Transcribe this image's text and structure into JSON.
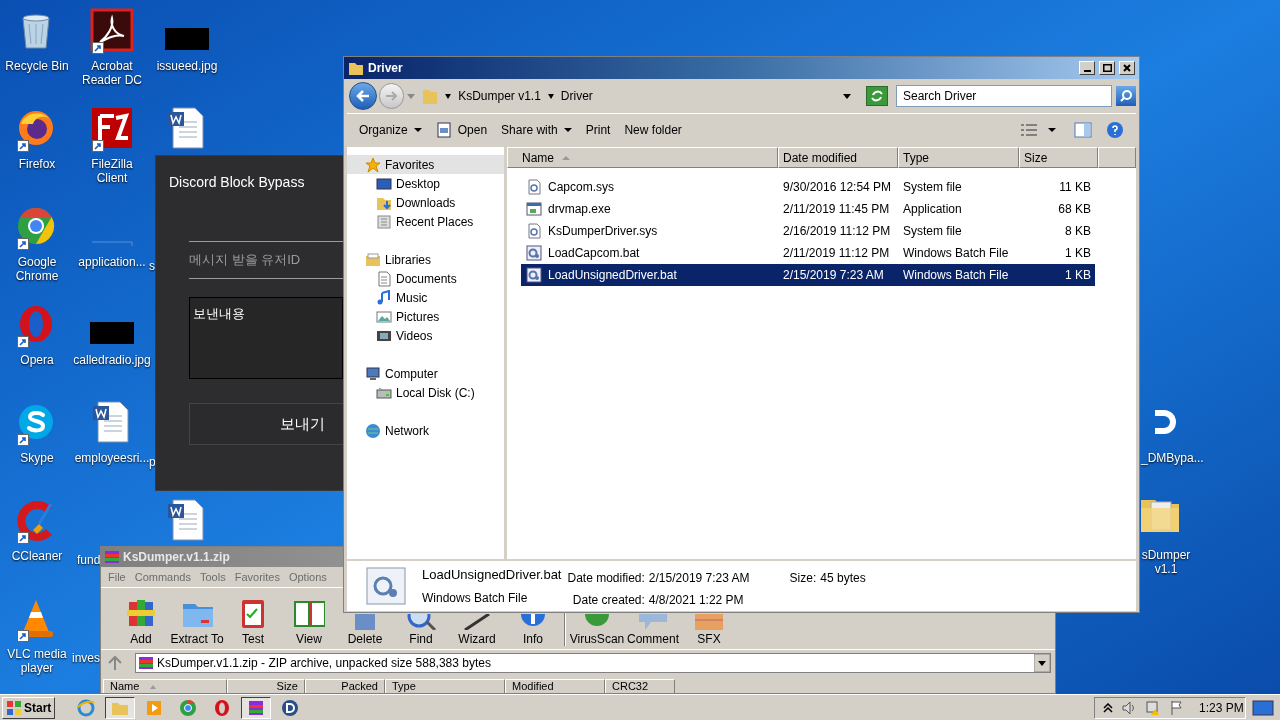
{
  "desktop": {
    "icons": [
      {
        "kind": "recycle",
        "label": "Recycle Bin",
        "shortcut": false
      },
      {
        "kind": "firefox",
        "label": "Firefox",
        "shortcut": true
      },
      {
        "kind": "chrome",
        "label": "Google Chrome",
        "shortcut": true
      },
      {
        "kind": "opera",
        "label": "Opera",
        "shortcut": true
      },
      {
        "kind": "skype",
        "label": "Skype",
        "shortcut": true
      },
      {
        "kind": "ccleaner",
        "label": "CCleaner",
        "shortcut": true
      },
      {
        "kind": "vlc",
        "label": "VLC media player",
        "shortcut": true
      },
      {
        "kind": "acrobat",
        "label": "Acrobat Reader DC",
        "shortcut": true
      },
      {
        "kind": "filezilla",
        "label": "FileZilla Client",
        "shortcut": true
      },
      {
        "kind": "blank",
        "label": "application...",
        "shortcut": false
      },
      {
        "kind": "black-image",
        "label": "calledradio.jpg",
        "shortcut": false
      },
      {
        "kind": "word",
        "label": "employeesri...",
        "shortcut": false
      },
      {
        "label": "fund"
      },
      {
        "label": "inves"
      },
      {
        "kind": "black-image",
        "label": "issueed.jpg",
        "shortcut": false
      },
      {
        "kind": "word",
        "shortcut": false
      },
      {
        "label": "s"
      },
      {
        "label": "p"
      },
      {
        "kind": "word",
        "shortcut": false
      },
      {
        "kind": "discord",
        "label": "_DMBypa...",
        "shortcut": false
      },
      {
        "kind": "folder",
        "label": "sDumper v1.1",
        "shortcut": false
      }
    ]
  },
  "discord_window": {
    "title": "Discord Block Bypass",
    "user_id_field": {
      "placeholder": "메시지 받을 유저ID"
    },
    "message_field": {
      "placeholder": "보낸내용"
    },
    "send_button": "보내기"
  },
  "winrar_window": {
    "title": "KsDumper.v1.1.zip",
    "menu": [
      "File",
      "Commands",
      "Tools",
      "Favorites",
      "Options"
    ],
    "toolbar": [
      {
        "kind": "add",
        "label": "Add"
      },
      {
        "kind": "extract",
        "label": "Extract To"
      },
      {
        "kind": "test",
        "label": "Test"
      },
      {
        "kind": "view",
        "label": "View"
      },
      {
        "kind": "delete",
        "label": "Delete"
      },
      {
        "kind": "find",
        "label": "Find"
      },
      {
        "kind": "wizard",
        "label": "Wizard"
      },
      {
        "kind": "info",
        "label": "Info"
      },
      {
        "kind": "separator"
      },
      {
        "kind": "virusscan",
        "label": "VirusScan"
      },
      {
        "kind": "comment",
        "label": "Comment"
      },
      {
        "kind": "sfx",
        "label": "SFX"
      }
    ],
    "path": "KsDumper.v1.1.zip - ZIP archive, unpacked size 588,383 bytes",
    "columns": [
      {
        "label": "Name",
        "sorted": true
      },
      {
        "label": "Size",
        "sorted": false
      },
      {
        "label": "Packed",
        "sorted": false
      },
      {
        "label": "Type",
        "sorted": false
      },
      {
        "label": "Modified",
        "sorted": false
      },
      {
        "label": "CRC32",
        "sorted": false
      }
    ]
  },
  "explorer_window": {
    "title": "Driver",
    "breadcrumb": [
      "KsDumper v1.1",
      "Driver"
    ],
    "search": {
      "placeholder": "Search Driver"
    },
    "toolbar": [
      {
        "label": "Organize",
        "dropdown": true,
        "kind": "text"
      },
      {
        "label": "Open",
        "dropdown": false,
        "kind": "open"
      },
      {
        "label": "Share with",
        "dropdown": true,
        "kind": "text"
      },
      {
        "label": "Print",
        "dropdown": false,
        "kind": "text"
      },
      {
        "label": "New folder",
        "dropdown": false,
        "kind": "text"
      }
    ],
    "navigation": [
      {
        "label": "Favorites",
        "kind": "star",
        "selected": true,
        "children": [
          {
            "label": "Desktop",
            "kind": "desktop",
            "selected": false
          },
          {
            "label": "Downloads",
            "kind": "downloads",
            "selected": false
          },
          {
            "label": "Recent Places",
            "kind": "recent",
            "selected": false
          }
        ]
      },
      {
        "label": "Libraries",
        "kind": "library",
        "selected": false,
        "children": [
          {
            "label": "Documents",
            "kind": "documents",
            "selected": false
          },
          {
            "label": "Music",
            "kind": "music",
            "selected": false
          },
          {
            "label": "Pictures",
            "kind": "pictures",
            "selected": false
          },
          {
            "label": "Videos",
            "kind": "videos",
            "selected": false
          }
        ]
      },
      {
        "label": "Computer",
        "kind": "computer",
        "selected": false,
        "children": [
          {
            "label": "Local Disk (C:)",
            "kind": "disk",
            "selected": false
          }
        ]
      },
      {
        "label": "Network",
        "kind": "network",
        "selected": false
      }
    ],
    "columns": [
      {
        "label": "Name",
        "sorted": true
      },
      {
        "label": "Date modified",
        "sorted": false
      },
      {
        "label": "Type",
        "sorted": false
      },
      {
        "label": "Size",
        "sorted": false
      }
    ],
    "files": [
      {
        "name": "Capcom.sys",
        "kind": "sys",
        "date": "9/30/2016 12:54 PM",
        "type": "System file",
        "size": "11 KB",
        "selected": false
      },
      {
        "name": "drvmap.exe",
        "kind": "exe",
        "date": "2/11/2019 11:45 PM",
        "type": "Application",
        "size": "68 KB",
        "selected": false
      },
      {
        "name": "KsDumperDriver.sys",
        "kind": "sys",
        "date": "2/16/2019 11:12 PM",
        "type": "System file",
        "size": "8 KB",
        "selected": false
      },
      {
        "name": "LoadCapcom.bat",
        "kind": "bat",
        "date": "2/11/2019 11:12 PM",
        "type": "Windows Batch File",
        "size": "1 KB",
        "selected": false
      },
      {
        "name": "LoadUnsignedDriver.bat",
        "kind": "bat",
        "date": "2/15/2019 7:23 AM",
        "type": "Windows Batch File",
        "size": "1 KB",
        "selected": true
      }
    ],
    "details": {
      "name": "LoadUnsignedDriver.bat",
      "type": "Windows Batch File",
      "fields": [
        {
          "label": "Date modified:",
          "value": "2/15/2019 7:23 AM"
        },
        {
          "label": "Size:",
          "value": "45 bytes"
        },
        {
          "label": "Date created:",
          "value": "4/8/2021 1:22 PM"
        }
      ]
    }
  },
  "taskbar": {
    "start": "Start",
    "buttons": [
      {
        "kind": "ie",
        "active": false
      },
      {
        "kind": "explorer",
        "active": true
      },
      {
        "kind": "media",
        "active": false
      },
      {
        "kind": "chrome",
        "active": false
      },
      {
        "kind": "opera",
        "active": false
      },
      {
        "kind": "winrar",
        "active": true
      },
      {
        "kind": "discord",
        "active": false
      }
    ],
    "tray": {
      "time": "1:23 PM"
    }
  }
}
